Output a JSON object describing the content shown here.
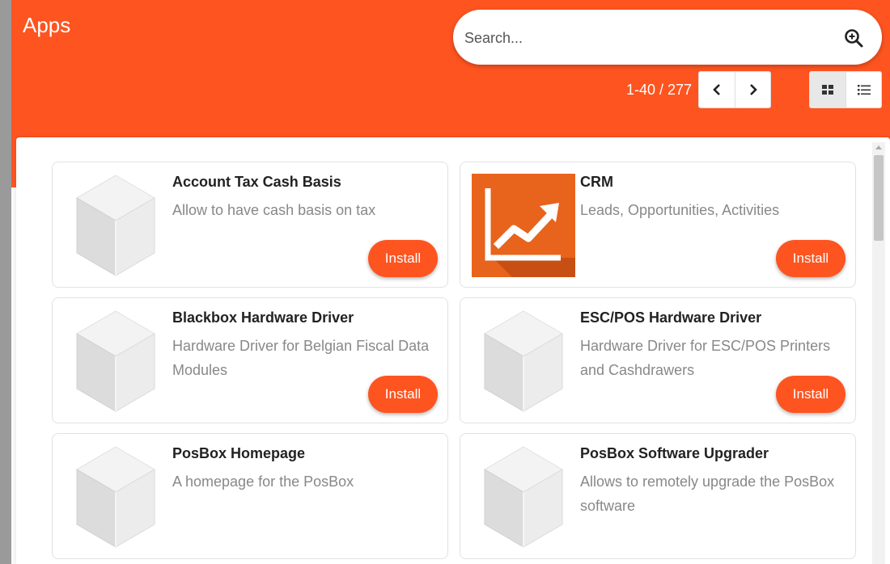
{
  "header": {
    "title": "Apps",
    "search_placeholder": "Search...",
    "pager_value": "1-40 / 277"
  },
  "colors": {
    "brand": "#fe5420",
    "muted_text": "#888888"
  },
  "icons": [
    "search-icon",
    "chevron-left-icon",
    "chevron-right-icon",
    "kanban-view-icon",
    "list-view-icon",
    "module-cube-icon",
    "crm-chart-icon"
  ],
  "apps": [
    {
      "name": "Account Tax Cash Basis",
      "description": "Allow to have cash basis on tax",
      "button": "Install"
    },
    {
      "name": "CRM",
      "description": "Leads, Opportunities, Activities",
      "button": "Install"
    },
    {
      "name": "Blackbox Hardware Driver",
      "description": "Hardware Driver for Belgian Fiscal Data Modules",
      "button": "Install"
    },
    {
      "name": "ESC/POS Hardware Driver",
      "description": "Hardware Driver for ESC/POS Printers and Cashdrawers",
      "button": "Install"
    },
    {
      "name": "PosBox Homepage",
      "description": "A homepage for the PosBox",
      "button": ""
    },
    {
      "name": "PosBox Software Upgrader",
      "description": "Allows to remotely upgrade the PosBox software",
      "button": ""
    }
  ]
}
